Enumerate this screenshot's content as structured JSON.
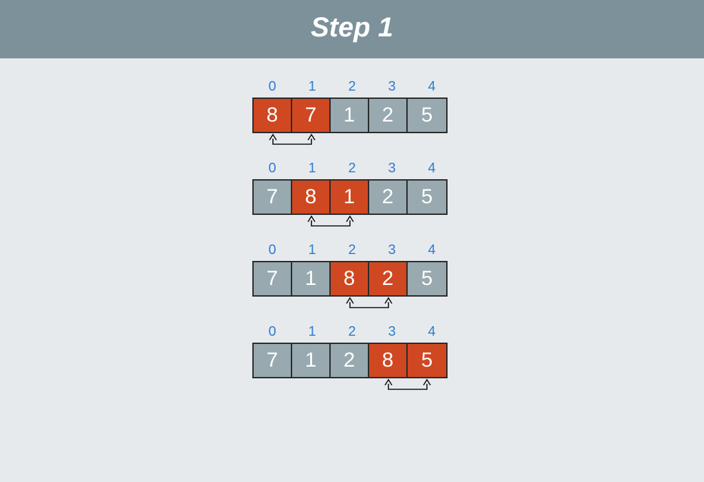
{
  "header": {
    "title": "Step 1"
  },
  "colors": {
    "normal": "#98a9b0",
    "highlight": "#d04821",
    "index": "#2d7dcf",
    "headerBg": "#7c919a",
    "pageBg": "#e6eaed"
  },
  "diagram": {
    "indices": [
      "0",
      "1",
      "2",
      "3",
      "4"
    ],
    "passes": [
      {
        "values": [
          "8",
          "7",
          "1",
          "2",
          "5"
        ],
        "highlight": [
          0,
          1
        ],
        "swap": [
          0,
          1
        ]
      },
      {
        "values": [
          "7",
          "8",
          "1",
          "2",
          "5"
        ],
        "highlight": [
          1,
          2
        ],
        "swap": [
          1,
          2
        ]
      },
      {
        "values": [
          "7",
          "1",
          "8",
          "2",
          "5"
        ],
        "highlight": [
          2,
          3
        ],
        "swap": [
          2,
          3
        ]
      },
      {
        "values": [
          "7",
          "1",
          "2",
          "8",
          "5"
        ],
        "highlight": [
          3,
          4
        ],
        "swap": [
          3,
          4
        ]
      }
    ]
  }
}
